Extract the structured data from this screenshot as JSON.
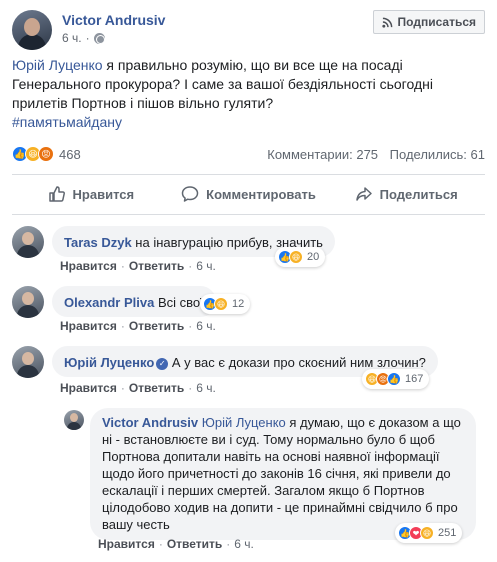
{
  "post": {
    "author": "Victor Andrusiv",
    "time": "6 ч.",
    "subscribe_label": "Подписаться",
    "mention": "Юрій Луценко",
    "text_rest": " я правильно розумію, що ви все ще на посаді Генерального прокурора? І саме за вашої бездіяльності сьогодні прилетів Портнов і пішов вільно гуляти?",
    "hashtag": "#памятьмайдану",
    "reactions_count": "468",
    "comments_stat": "Комментарии: 275",
    "shares_stat": "Поделились: 61"
  },
  "actions": {
    "like": "Нравится",
    "comment": "Комментировать",
    "share": "Поделиться"
  },
  "comments": [
    {
      "name": "Taras Dzyk",
      "text": " на інавгурацію прибув, значить",
      "like": "Нравится",
      "reply": "Ответить",
      "time": "6 ч.",
      "reactions": "20"
    },
    {
      "name": "Olexandr Pliva",
      "text": " Всі свої",
      "like": "Нравится",
      "reply": "Ответить",
      "time": "6 ч.",
      "reactions": "12"
    },
    {
      "name": "Юрій Луценко",
      "text": "А у вас є докази про скоєний ним злочин?",
      "like": "Нравится",
      "reply": "Ответить",
      "time": "6 ч.",
      "reactions": "167"
    }
  ],
  "reply": {
    "name": "Victor Andrusiv",
    "mention": "Юрій Луценко",
    "text": " я думаю, що є доказом а що ні - встановлюєте ви і суд. Тому нормально було б щоб Портнова допитали навіть на основі наявної інформації щодо його причетності до законів 16 січня, які привели до ескалації і перших смертей. Загалом якщо б Портнов цілодобово ходив на допити - це принаймні свідчило б про вашу честь",
    "like": "Нравится",
    "reply_label": "Ответить",
    "time": "6 ч.",
    "reactions": "251"
  },
  "separator": "·",
  "colors": {
    "link": "#385898",
    "like": "#1877f2",
    "angry": "#e9710f",
    "haha": "#f7b125",
    "love": "#f33e58"
  }
}
